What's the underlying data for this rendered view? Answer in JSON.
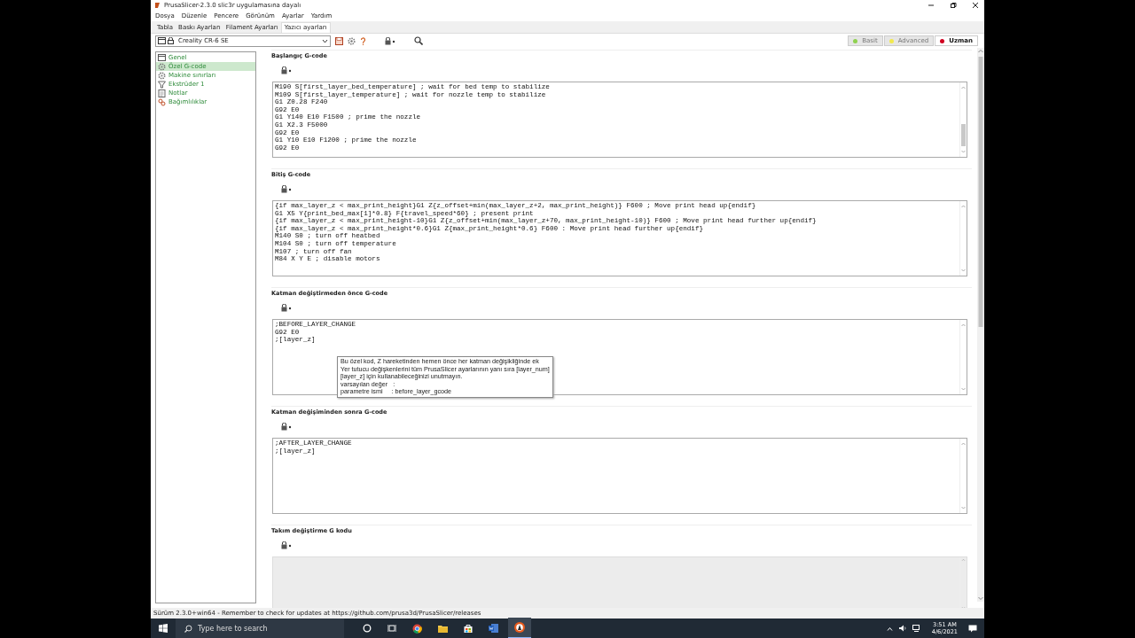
{
  "window": {
    "title": "PrusaSlicer-2.3.0 slic3r uygulamasına dayalı"
  },
  "menu": [
    "Dosya",
    "Düzenle",
    "Pencere",
    "Görünüm",
    "Ayarlar",
    "Yardım"
  ],
  "tabs": [
    {
      "label": "Tabla",
      "selected": false
    },
    {
      "label": "Baskı Ayarları",
      "selected": false
    },
    {
      "label": "Filament Ayarları",
      "selected": false
    },
    {
      "label": "Yazıcı ayarları",
      "selected": true
    }
  ],
  "preset": {
    "value": "Creality CR-6 SE"
  },
  "modes": [
    {
      "label": "Basit",
      "color": "#8fd14f",
      "selected": false
    },
    {
      "label": "Advanced",
      "color": "#f2e94e",
      "selected": false
    },
    {
      "label": "Uzman",
      "color": "#d00020",
      "selected": true
    }
  ],
  "sidebar": {
    "items": [
      {
        "label": "Genel",
        "kind": "window",
        "selected": false
      },
      {
        "label": "Özel G-code",
        "kind": "gear",
        "selected": true
      },
      {
        "label": "Makine sınırları",
        "kind": "gear",
        "selected": false
      },
      {
        "label": "Ekstrüder 1",
        "kind": "funnel",
        "selected": false
      },
      {
        "label": "Notlar",
        "kind": "note",
        "selected": false
      },
      {
        "label": "Bağımlılıklar",
        "kind": "link",
        "selected": false
      }
    ]
  },
  "sections": [
    {
      "title": "Başlangıç G-code",
      "lines": [
        "M190 S[first_layer_bed_temperature] ; wait for bed temp to stabilize",
        "M109 S[first_layer_temperature] ; wait for nozzle temp to stabilize",
        "G1 Z0.28 F240",
        "G92 E0",
        "G1 Y140 E10 F1500 ; prime the nozzle",
        "G1 X2.3 F5000",
        "G92 E0",
        "G1 Y10 E10 F1200 ; prime the nozzle",
        "G92 E0"
      ]
    },
    {
      "title": "Bitiş G-code",
      "lines": [
        "{if max_layer_z < max_print_height}G1 Z{z_offset+min(max_layer_z+2, max_print_height)} F600 ; Move print head up{endif}",
        "G1 X5 Y{print_bed_max[1]*0.8} F{travel_speed*60} ; present print",
        "{if max_layer_z < max_print_height-10}G1 Z{z_offset+min(max_layer_z+70, max_print_height-10)} F600 ; Move print head further up{endif}",
        "{if max_layer_z < max_print_height*0.6}G1 Z{max_print_height*0.6} F600 : Move print head further up{endif}",
        "M140 S0 ; turn off heatbed",
        "M104 S0 ; turn off temperature",
        "M107 ; turn off fan",
        "M84 X Y E ; disable motors"
      ]
    },
    {
      "title": "Katman değiştirmeden önce G-code",
      "lines": [
        ";BEFORE_LAYER_CHANGE",
        "G92 E0",
        ";[layer_z]"
      ],
      "tooltip": {
        "lines": [
          "Bu özel kod, Z hareketinden hemen önce her katman değişikliğinde ek",
          "Yer tutucu değişkenlerini tüm PrusaSlicer ayarlarının yanı sıra [layer_num]",
          "[layer_z] için kullanabileceğinizi unutmayın.",
          "varsayılan değer   :",
          "parametre ismi     : before_layer_gcode"
        ]
      }
    },
    {
      "title": "Katman değişiminden sonra G-code",
      "lines": [
        ";AFTER_LAYER_CHANGE",
        ";[layer_z]"
      ]
    },
    {
      "title": "Takım değiştirme G kodu",
      "disabled": true
    }
  ],
  "status_bar": "Sürüm 2.3.0+win64 - Remember to check for updates at https://github.com/prusa3d/PrusaSlicer/releases",
  "taskbar": {
    "search_placeholder": "Type here to search",
    "time": "3:51 AM",
    "date": "4/6/2021"
  }
}
